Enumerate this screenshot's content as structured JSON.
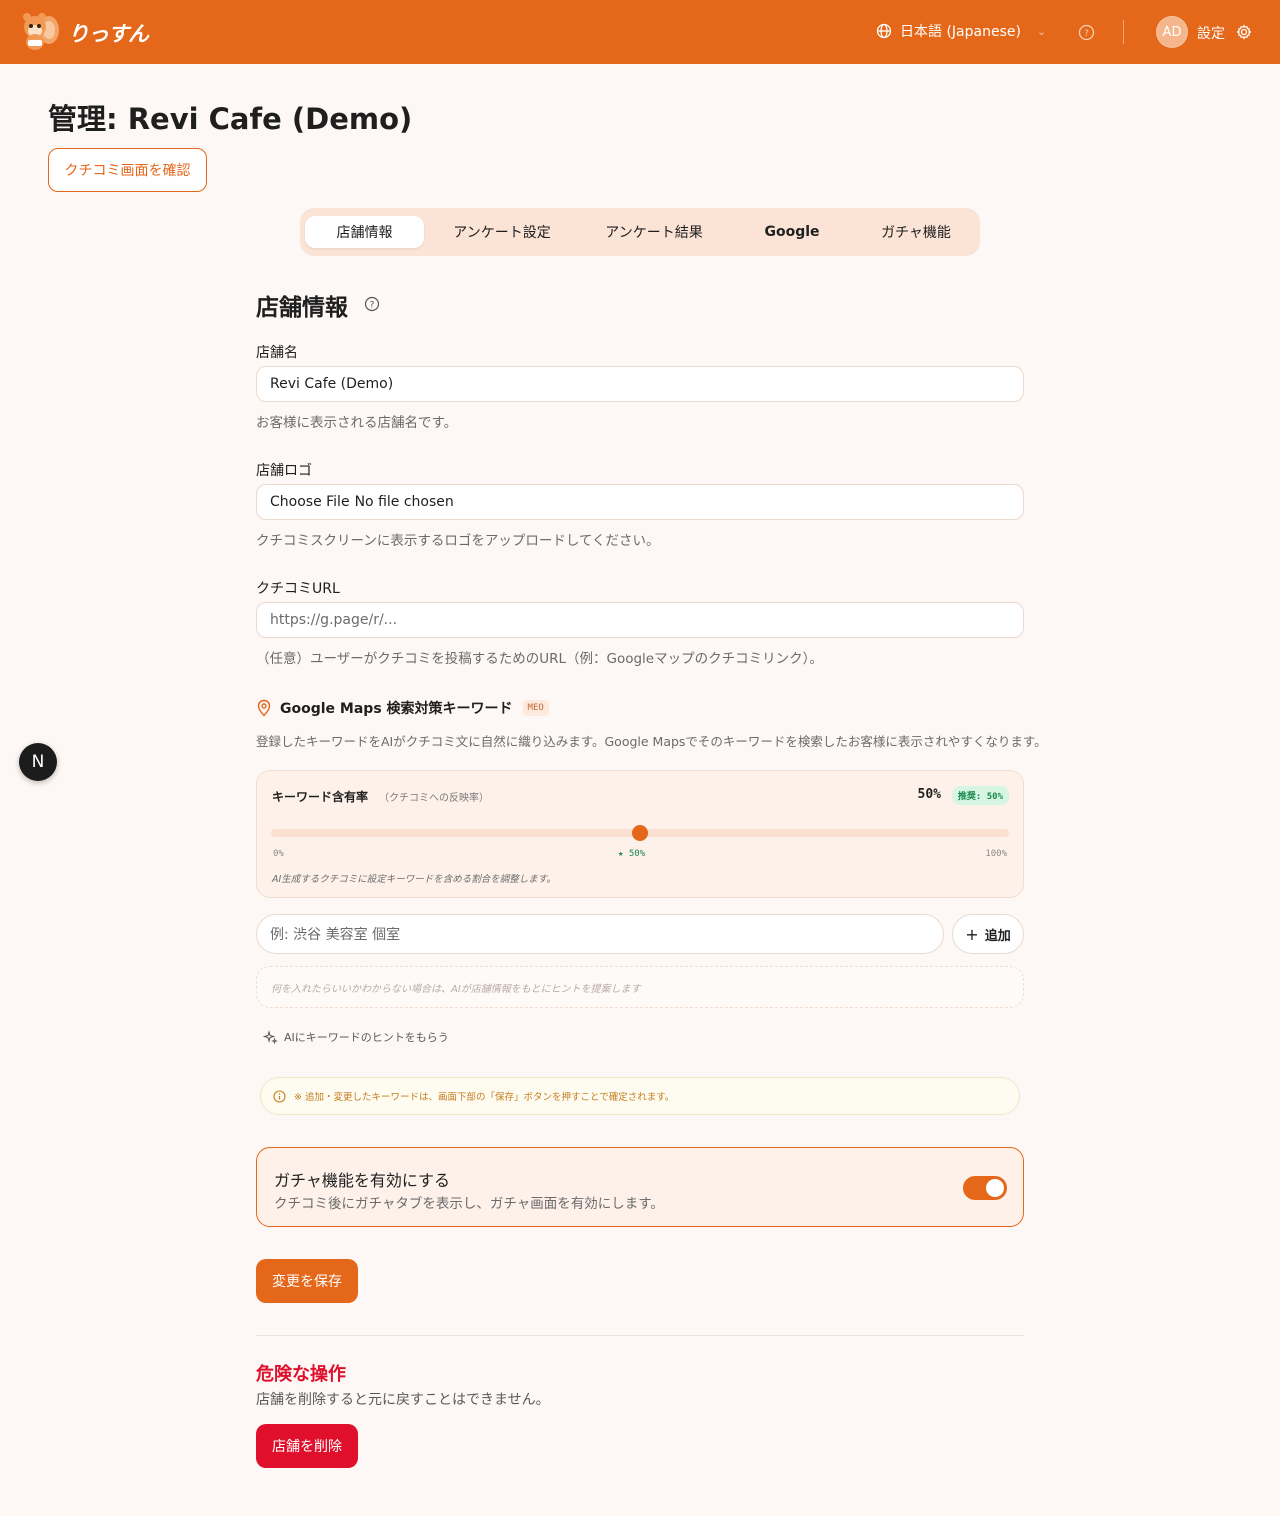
{
  "header": {
    "brand": "りっすん",
    "language": "日本語 (Japanese)",
    "avatar_initials": "AD",
    "settings_label": "設定"
  },
  "page": {
    "title": "管理: Revi Cafe (Demo)",
    "view_reviews_button": "クチコミ画面を確認"
  },
  "tabs": [
    {
      "label": "店舗情報",
      "active": true
    },
    {
      "label": "アンケート設定",
      "active": false
    },
    {
      "label": "アンケート結果",
      "active": false
    },
    {
      "label": "Google",
      "active": false
    },
    {
      "label": "ガチャ機能",
      "active": false
    }
  ],
  "store_info": {
    "section_title": "店舗情報",
    "name_label": "店舗名",
    "name_value": "Revi Cafe (Demo)",
    "name_help": "お客様に表示される店舗名です。",
    "logo_label": "店舗ロゴ",
    "logo_button": "Choose File",
    "logo_status": "No file chosen",
    "logo_help": "クチコミスクリーンに表示するロゴをアップロードしてください。",
    "url_label": "クチコミURL",
    "url_placeholder": "https://g.page/r/...",
    "url_help": "（任意）ユーザーがクチコミを投稿するためのURL（例：Googleマップのクチコミリンク）。"
  },
  "meo": {
    "title": "Google Maps 検索対策キーワード",
    "badge": "MEO",
    "description": "登録したキーワードをAIがクチコミ文に自然に織り込みます。Google Mapsでそのキーワードを検索したお客様に表示されやすくなります。",
    "rate_label": "キーワード含有率",
    "rate_sub": "（クチコミへの反映率）",
    "rate_value": "50%",
    "rate_fraction": 0.5,
    "recommend_badge": "推奨: 50%",
    "tick_min": "0%",
    "tick_mid": "★ 50%",
    "tick_max": "100%",
    "rate_note": "AI生成するクチコミに設定キーワードを含める割合を調整します。",
    "keyword_placeholder": "例: 渋谷 美容室 個室",
    "add_button": "追加",
    "hint_box": "何を入れたらいいかわからない場合は、AIが店舗情報をもとにヒントを提案します",
    "ai_hint": "AIにキーワードのヒントをもらう",
    "notice": "※ 追加・変更したキーワードは、画面下部の「保存」ボタンを押すことで確定されます。"
  },
  "gacha": {
    "title": "ガチャ機能を有効にする",
    "description": "クチコミ後にガチャタブを表示し、ガチャ画面を有効にします。",
    "enabled": true
  },
  "save_button": "変更を保存",
  "danger": {
    "title": "危険な操作",
    "description": "店舗を削除すると元に戻すことはできません。",
    "delete_button": "店舗を削除"
  },
  "floating_badge": "N",
  "colors": {
    "accent": "#e4671a",
    "danger": "#e0102d",
    "success": "#1a8a4b",
    "background": "#fdf8f5"
  }
}
